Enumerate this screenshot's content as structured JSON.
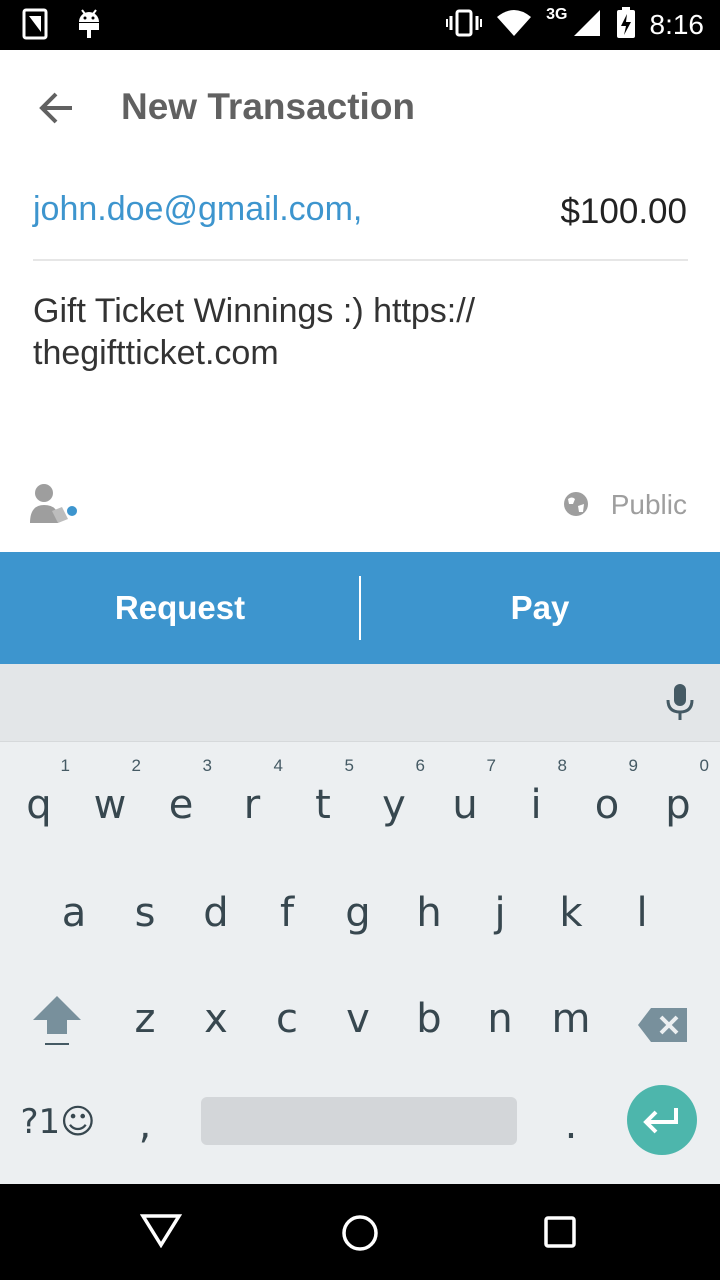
{
  "status_bar": {
    "time": "8:16",
    "network": "3G",
    "icons": [
      "notification-icon",
      "android-icon",
      "vibrate-icon",
      "wifi-icon",
      "signal-icon",
      "battery-charging-icon"
    ]
  },
  "app_bar": {
    "title": "New Transaction",
    "back_icon": "arrow-back-icon"
  },
  "transaction": {
    "recipient": "john.doe@gmail.com,",
    "amount": "$100.00",
    "note": "Gift Ticket Winnings :) https:// thegiftticket.com",
    "privacy_label": "Public"
  },
  "actions": {
    "request_label": "Request",
    "pay_label": "Pay"
  },
  "keyboard": {
    "row1": [
      {
        "k": "q",
        "n": "1"
      },
      {
        "k": "w",
        "n": "2"
      },
      {
        "k": "e",
        "n": "3"
      },
      {
        "k": "r",
        "n": "4"
      },
      {
        "k": "t",
        "n": "5"
      },
      {
        "k": "y",
        "n": "6"
      },
      {
        "k": "u",
        "n": "7"
      },
      {
        "k": "i",
        "n": "8"
      },
      {
        "k": "o",
        "n": "9"
      },
      {
        "k": "p",
        "n": "0"
      }
    ],
    "row2": [
      "a",
      "s",
      "d",
      "f",
      "g",
      "h",
      "j",
      "k",
      "l"
    ],
    "row3": [
      "z",
      "x",
      "c",
      "v",
      "b",
      "n",
      "m"
    ],
    "symbols_label": "?1☺",
    "comma": ",",
    "period": "."
  },
  "colors": {
    "accent": "#3d95ce",
    "enter_key": "#4db6ac",
    "keyboard_bg": "#eceff1"
  }
}
